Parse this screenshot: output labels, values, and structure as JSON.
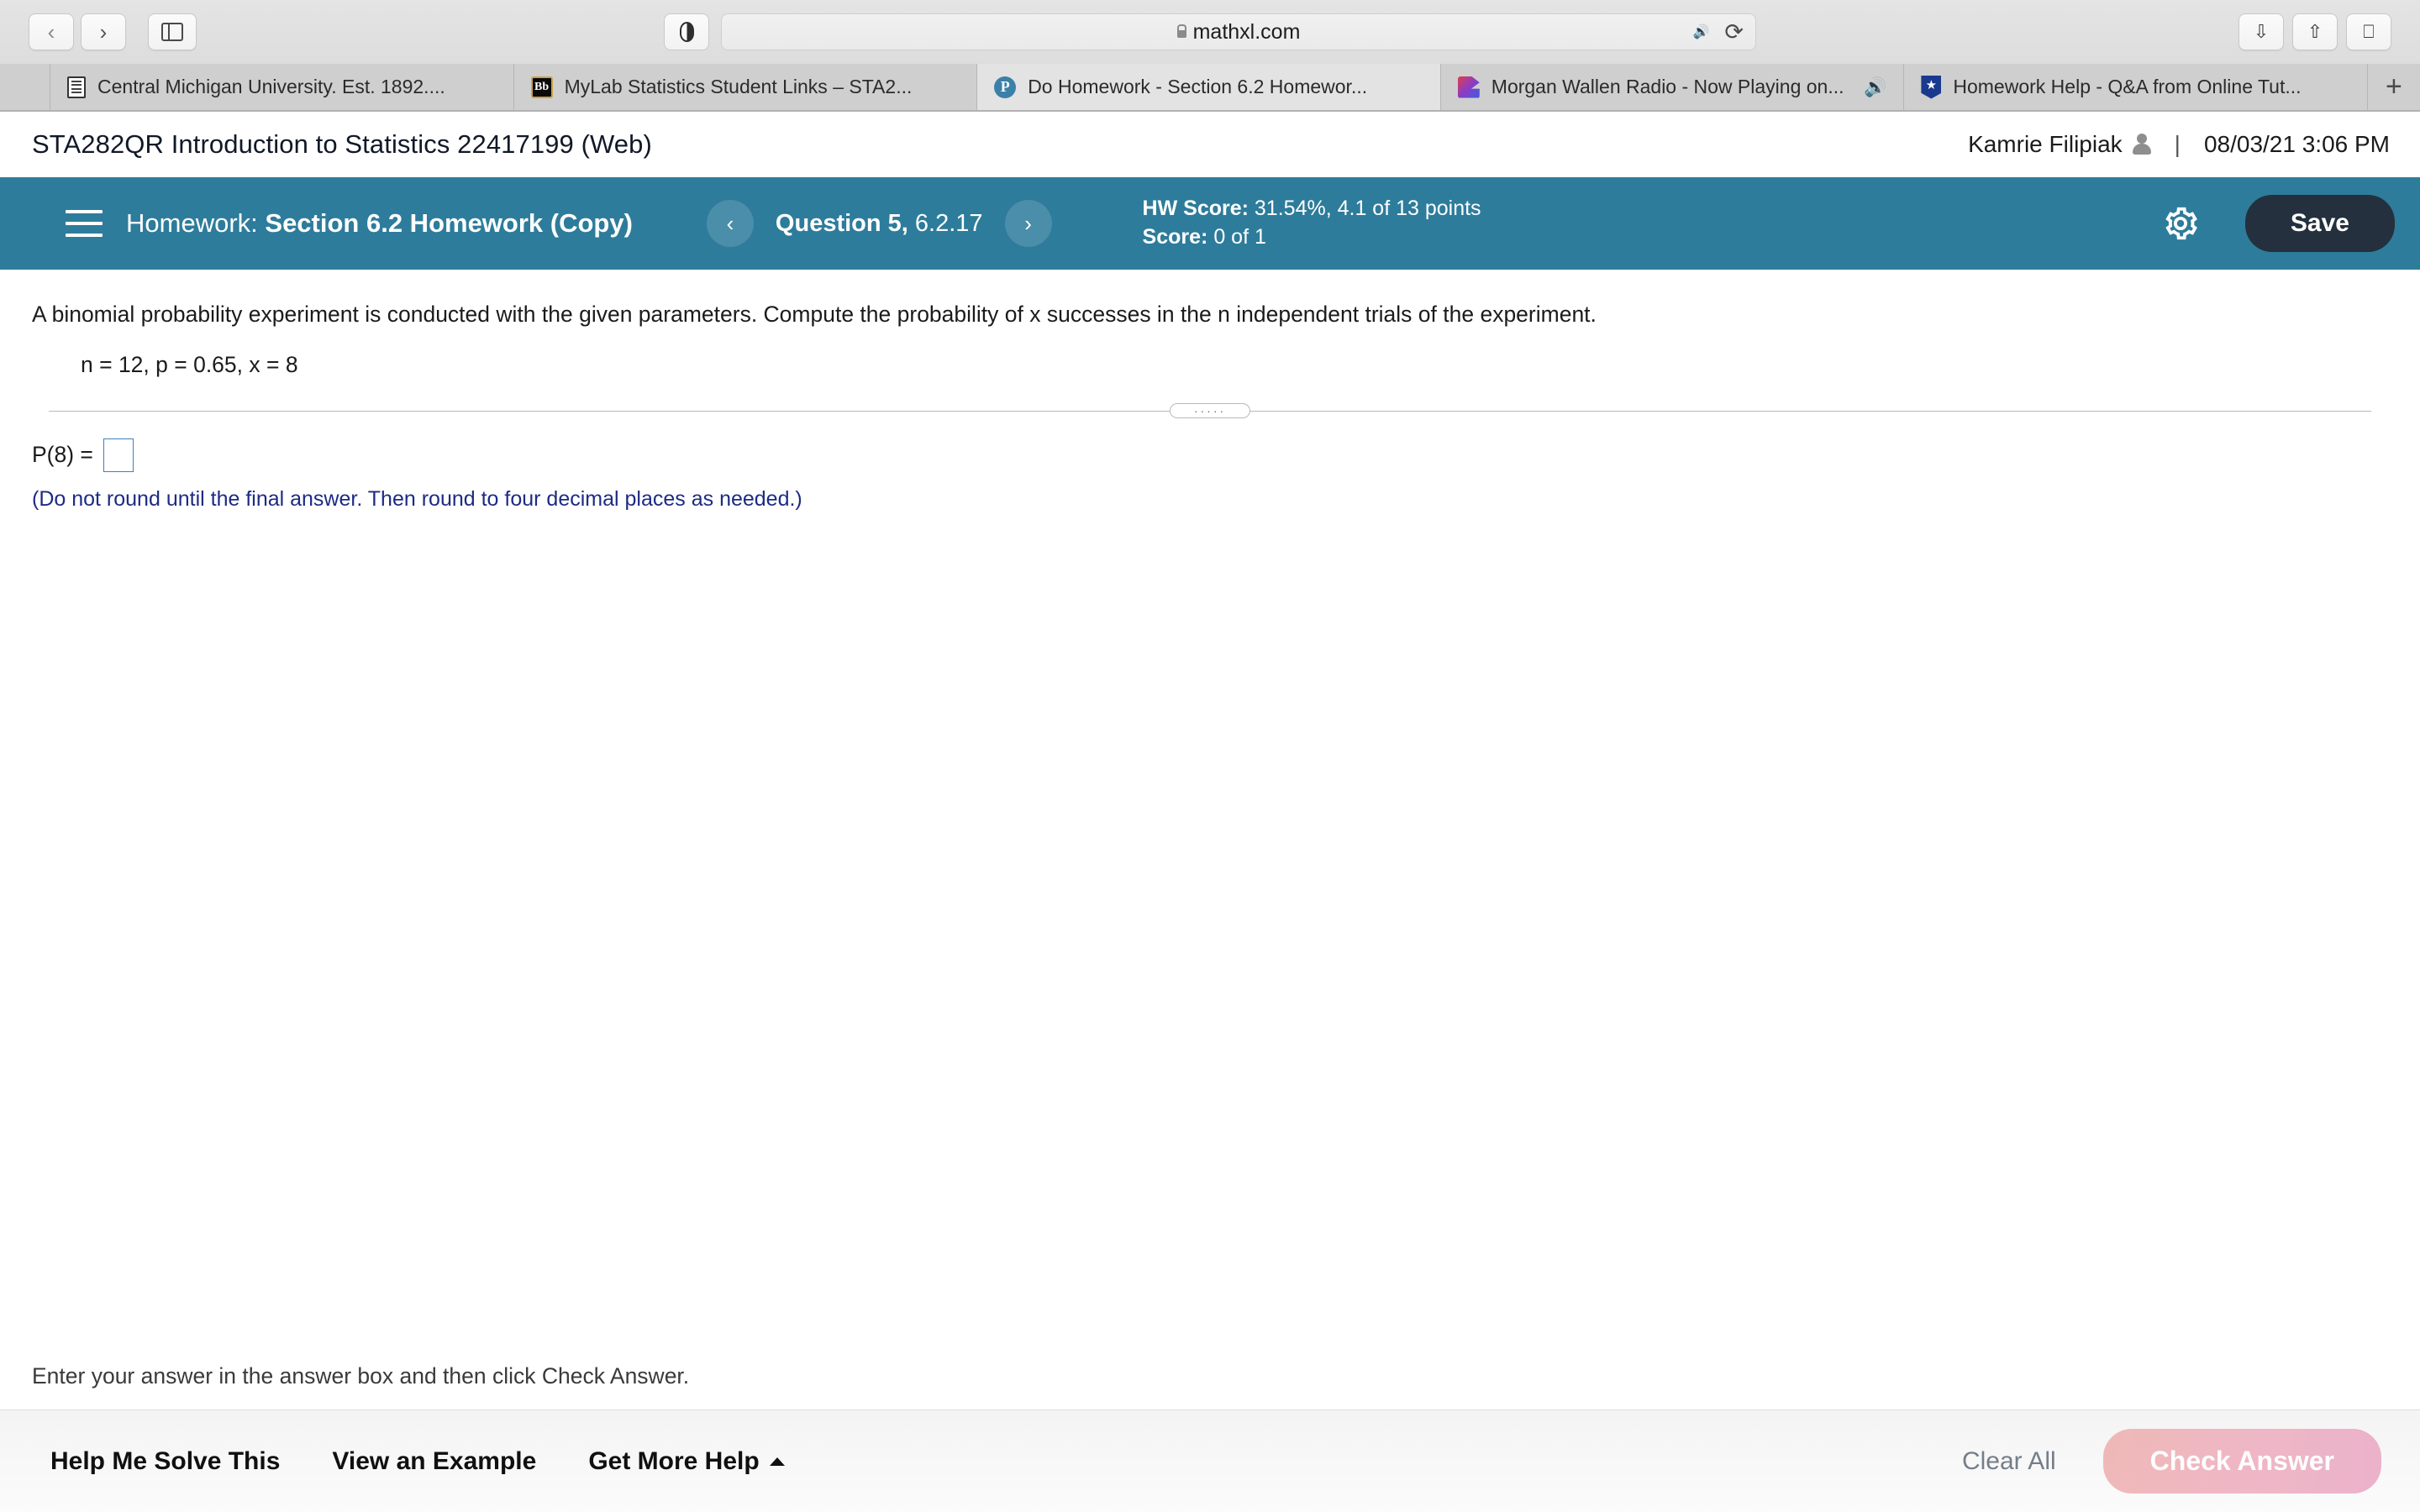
{
  "browser": {
    "url": "mathxl.com",
    "lock_icon": "lock-icon",
    "back_icon": "chevron-left-icon",
    "forward_icon": "chevron-right-icon",
    "sidebar_icon": "sidebar-toggle-icon",
    "shield_icon": "privacy-shield-icon",
    "audio_icon": "speaker-icon",
    "reload_icon": "reload-icon",
    "download_icon": "download-icon",
    "share_icon": "share-icon",
    "tabs_overview_icon": "tab-overview-icon",
    "new_tab_icon": "plus-icon",
    "tabs": [
      {
        "title": "Central Michigan University. Est. 1892....",
        "favicon": "document-icon",
        "active": false,
        "audio": false
      },
      {
        "title": "MyLab Statistics Student Links – STA2...",
        "favicon": "blackboard-icon",
        "active": false,
        "audio": false
      },
      {
        "title": "Do Homework - Section 6.2 Homewor...",
        "favicon": "pearson-icon",
        "active": true,
        "audio": false
      },
      {
        "title": "Morgan Wallen Radio - Now Playing on...",
        "favicon": "pandora-icon",
        "active": false,
        "audio": true
      },
      {
        "title": "Homework Help - Q&A from Online Tut...",
        "favicon": "coursehero-icon",
        "active": false,
        "audio": false
      }
    ]
  },
  "header": {
    "course_title": "STA282QR Introduction to Statistics 22417199 (Web)",
    "user_name": "Kamrie Filipiak",
    "user_icon": "person-icon",
    "separator": "|",
    "timestamp": "08/03/21 3:06 PM"
  },
  "toolbar": {
    "menu_icon": "hamburger-menu-icon",
    "homework_prefix": "Homework:",
    "homework_name": "Section 6.2 Homework (Copy)",
    "prev_icon": "‹",
    "next_icon": "›",
    "question_label": "Question 5,",
    "question_id": "6.2.17",
    "hw_score_label": "HW Score:",
    "hw_score_value": "31.54%, 4.1 of 13 points",
    "score_label": "Score:",
    "score_value": "0 of 1",
    "settings_icon": "gear-icon",
    "save_label": "Save",
    "accent_color": "#2e7c9b",
    "save_color": "#24303d"
  },
  "question": {
    "stem": "A binomial probability experiment is conducted with the given parameters. Compute the probability of x successes in the n independent trials of the experiment.",
    "parameters": "n = 12, p = 0.65, x = 8",
    "splitter_dots": "·····",
    "answer_prefix": "P(8) =",
    "answer_value": "",
    "answer_placeholder": "",
    "rounding_note": "(Do not round until the final answer. Then round to four decimal places as needed.)",
    "note_color": "#1d2b84"
  },
  "footer": {
    "instruction": "Enter your answer in the answer box and then click Check Answer.",
    "help_me_solve": "Help Me Solve This",
    "view_example": "View an Example",
    "get_more_help": "Get More Help",
    "get_more_help_caret": "caret-up-icon",
    "clear_all": "Clear All",
    "check_answer": "Check Answer",
    "check_answer_color": "#eeb0ae"
  }
}
